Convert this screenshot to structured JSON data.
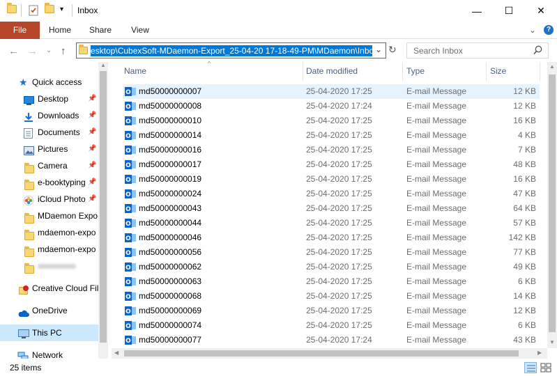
{
  "window": {
    "title": "Inbox",
    "controls": {
      "minimize": "—",
      "maximize": "☐",
      "close": "✕"
    }
  },
  "ribbon": {
    "tabs": [
      "File",
      "Home",
      "Share",
      "View"
    ],
    "expand": "⌄",
    "help": "?"
  },
  "address": {
    "path": "esktop\\CubexSoft-MDaemon-Export_25-04-20 17-18-49-PM\\MDaemon\\Inbox",
    "dropdown": "⌄",
    "refresh": "↻"
  },
  "search": {
    "placeholder": "Search Inbox"
  },
  "nav": {
    "items": [
      {
        "label": "Quick access",
        "icon": "star-icon",
        "color": "#1a73c9"
      },
      {
        "label": "Desktop",
        "icon": "desktop-icon",
        "color": "#1e88e5",
        "pinned": true
      },
      {
        "label": "Downloads",
        "icon": "download-icon",
        "color": "#1e6fd0",
        "pinned": true
      },
      {
        "label": "Documents",
        "icon": "document-icon",
        "color": "#7a8aa0",
        "pinned": true
      },
      {
        "label": "Pictures",
        "icon": "picture-icon",
        "color": "#4b6c9a",
        "pinned": true
      },
      {
        "label": "Camera",
        "icon": "folder-icon",
        "color": "#f8d775",
        "pinned": true
      },
      {
        "label": "e-booktyping",
        "icon": "folder-icon",
        "color": "#f8d775",
        "pinned": true
      },
      {
        "label": "iCloud Photo",
        "icon": "icloud-photos-icon",
        "color": "#e84c3d",
        "pinned": true
      },
      {
        "label": "MDaemon Expo",
        "icon": "folder-icon",
        "color": "#f8d775"
      },
      {
        "label": "mdaemon-expo",
        "icon": "folder-icon",
        "color": "#f8d775"
      },
      {
        "label": "mdaemon-expo",
        "icon": "folder-icon",
        "color": "#f8d775"
      },
      {
        "label": "",
        "icon": "folder-icon",
        "color": "#f8d775"
      },
      {
        "label": "Creative Cloud Fil",
        "icon": "creative-cloud-icon",
        "color": "#da1f26"
      },
      {
        "label": "OneDrive",
        "icon": "onedrive-icon",
        "color": "#0a64c8"
      },
      {
        "label": "This PC",
        "icon": "pc-icon",
        "color": "#3a7bd5"
      },
      {
        "label": "Network",
        "icon": "network-icon",
        "color": "#1e6fd0"
      }
    ],
    "pin_glyph": "📌"
  },
  "columns": {
    "name": "Name",
    "date": "Date modified",
    "type": "Type",
    "size": "Size"
  },
  "files": [
    {
      "name": "md50000000007",
      "date": "25-04-2020 17:25",
      "type": "E-mail Message",
      "size": "12 KB"
    },
    {
      "name": "md50000000008",
      "date": "25-04-2020 17:24",
      "type": "E-mail Message",
      "size": "12 KB"
    },
    {
      "name": "md50000000010",
      "date": "25-04-2020 17:25",
      "type": "E-mail Message",
      "size": "16 KB"
    },
    {
      "name": "md50000000014",
      "date": "25-04-2020 17:25",
      "type": "E-mail Message",
      "size": "4 KB"
    },
    {
      "name": "md50000000016",
      "date": "25-04-2020 17:25",
      "type": "E-mail Message",
      "size": "7 KB"
    },
    {
      "name": "md50000000017",
      "date": "25-04-2020 17:25",
      "type": "E-mail Message",
      "size": "48 KB"
    },
    {
      "name": "md50000000019",
      "date": "25-04-2020 17:25",
      "type": "E-mail Message",
      "size": "16 KB"
    },
    {
      "name": "md50000000024",
      "date": "25-04-2020 17:25",
      "type": "E-mail Message",
      "size": "47 KB"
    },
    {
      "name": "md50000000043",
      "date": "25-04-2020 17:25",
      "type": "E-mail Message",
      "size": "64 KB"
    },
    {
      "name": "md50000000044",
      "date": "25-04-2020 17:25",
      "type": "E-mail Message",
      "size": "57 KB"
    },
    {
      "name": "md50000000046",
      "date": "25-04-2020 17:25",
      "type": "E-mail Message",
      "size": "142 KB"
    },
    {
      "name": "md50000000056",
      "date": "25-04-2020 17:25",
      "type": "E-mail Message",
      "size": "77 KB"
    },
    {
      "name": "md50000000062",
      "date": "25-04-2020 17:25",
      "type": "E-mail Message",
      "size": "49 KB"
    },
    {
      "name": "md50000000063",
      "date": "25-04-2020 17:25",
      "type": "E-mail Message",
      "size": "6 KB"
    },
    {
      "name": "md50000000068",
      "date": "25-04-2020 17:25",
      "type": "E-mail Message",
      "size": "14 KB"
    },
    {
      "name": "md50000000069",
      "date": "25-04-2020 17:25",
      "type": "E-mail Message",
      "size": "12 KB"
    },
    {
      "name": "md50000000074",
      "date": "25-04-2020 17:25",
      "type": "E-mail Message",
      "size": "6 KB"
    },
    {
      "name": "md50000000077",
      "date": "25-04-2020 17:24",
      "type": "E-mail Message",
      "size": "43 KB"
    }
  ],
  "status": {
    "count": "25 items"
  },
  "colors": {
    "accent": "#0078d7",
    "file_tab": "#b6462a",
    "selection": "#cce8ff",
    "outlook": "#0a64c8"
  }
}
